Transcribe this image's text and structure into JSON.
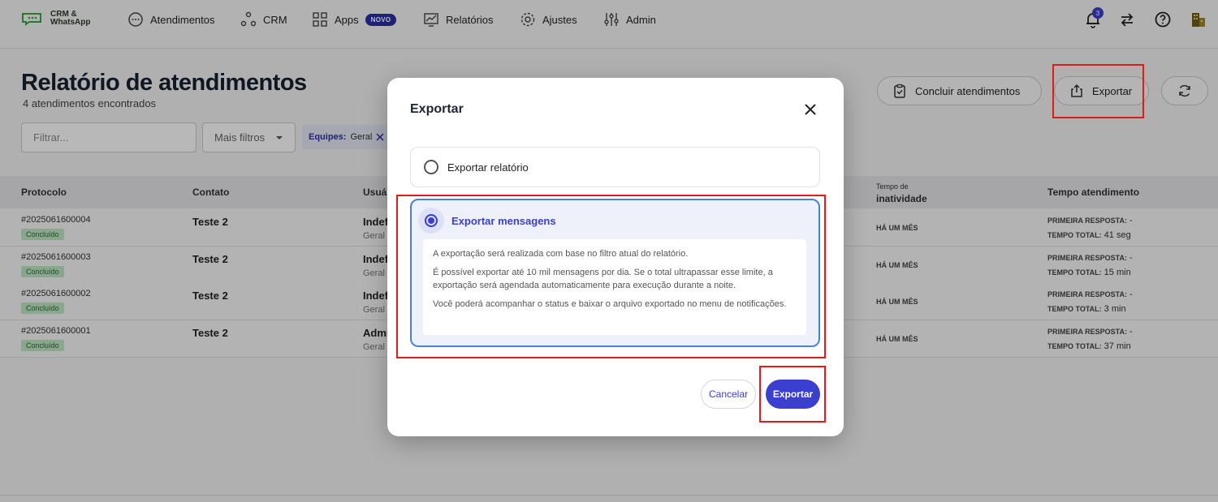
{
  "logo": {
    "line1": "CRM &",
    "line2": "WhatsApp"
  },
  "nav": {
    "items": [
      {
        "label": "Atendimentos",
        "icon": "chat-bubble-icon"
      },
      {
        "label": "CRM",
        "icon": "crm-nodes-icon"
      },
      {
        "label": "Apps",
        "icon": "apps-grid-icon",
        "badge": "NOVO"
      },
      {
        "label": "Relatórios",
        "icon": "chart-icon"
      },
      {
        "label": "Ajustes",
        "icon": "gear-icon"
      },
      {
        "label": "Admin",
        "icon": "sliders-icon"
      }
    ],
    "notification_count": "3"
  },
  "page": {
    "title": "Relatório de atendimentos",
    "subtitle": "4 atendimentos encontrados",
    "conclude_label": "Concluir atendimentos",
    "export_label": "Exportar"
  },
  "filters": {
    "search_placeholder": "Filtrar...",
    "more_filters": "Mais filtros",
    "chip_label": "Equipes:",
    "chip_value": "Geral"
  },
  "table": {
    "headers": {
      "protocol": "Protocolo",
      "contact": "Contato",
      "user": "Usuá",
      "inactivity_small": "Tempo de",
      "inactivity": "inatividade",
      "service_time": "Tempo atendimento"
    },
    "rows": [
      {
        "protocol": "#2025061600004",
        "status": "Concluído",
        "contact": "Teste 2",
        "user": "Indef",
        "team": "Geral",
        "inactivity": "HÁ UM MÊS",
        "first_label": "PRIMEIRA RESPOSTA:",
        "first_value": "-",
        "total_label": "TEMPO TOTAL:",
        "total_value": "41 seg"
      },
      {
        "protocol": "#2025061600003",
        "status": "Concluído",
        "contact": "Teste 2",
        "user": "Indef",
        "team": "Geral",
        "inactivity": "HÁ UM MÊS",
        "first_label": "PRIMEIRA RESPOSTA:",
        "first_value": "-",
        "total_label": "TEMPO TOTAL:",
        "total_value": "15 min"
      },
      {
        "protocol": "#2025061600002",
        "status": "Concluído",
        "contact": "Teste 2",
        "user": "Indef",
        "team": "Geral",
        "inactivity": "HÁ UM MÊS",
        "first_label": "PRIMEIRA RESPOSTA:",
        "first_value": "-",
        "total_label": "TEMPO TOTAL:",
        "total_value": "3 min"
      },
      {
        "protocol": "#2025061600001",
        "status": "Concluído",
        "contact": "Teste 2",
        "user": "Admi",
        "team": "Geral",
        "inactivity": "HÁ UM MÊS",
        "first_label": "PRIMEIRA RESPOSTA:",
        "first_value": "-",
        "total_label": "TEMPO TOTAL:",
        "total_value": "37 min"
      }
    ]
  },
  "modal": {
    "title": "Exportar",
    "option1": "Exportar relatório",
    "option2": "Exportar mensagens",
    "info": [
      "A exportação será realizada com base no filtro atual do relatório.",
      "É possível exportar até 10 mil mensagens por dia. Se o total ultrapassar esse limite, a exportação será agendada automaticamente para execução durante a noite.",
      "Você poderá acompanhar o status e baixar o arquivo exportado no menu de notificações."
    ],
    "cancel_label": "Cancelar",
    "export_label": "Exportar"
  },
  "colors": {
    "accent": "#3b3fcf",
    "highlight": "#e01b1b",
    "status_bg": "#bfe6c4"
  }
}
